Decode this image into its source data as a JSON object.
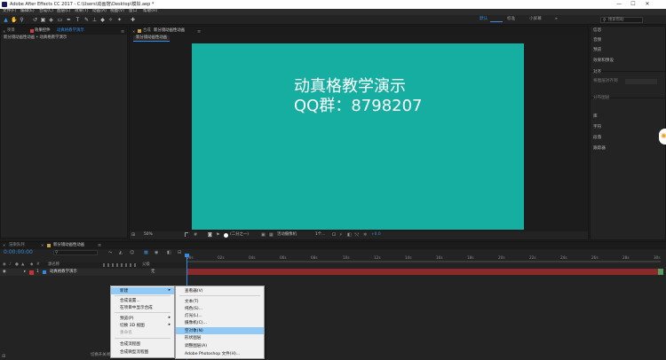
{
  "window": {
    "title": "Adobe After Effects CC 2017 - C:\\Users\\动画馆\\Desktop\\模拟.aep *",
    "minimize": "—",
    "maximize": "☐",
    "close": "✕"
  },
  "menubar": [
    "文件(F)",
    "编辑(E)",
    "合成(C)",
    "图层(L)",
    "效果(T)",
    "动画(A)",
    "视图(V)",
    "窗口",
    "帮助(H)"
  ],
  "toolbar": {
    "workspaces": [
      "默认",
      "标准",
      "小屏幕"
    ],
    "active_workspace": "默认",
    "more": "»",
    "search_placeholder": "搜索帮助"
  },
  "project_panel": {
    "tab_project": "项目",
    "tab_effect_controls": "效果控件",
    "tab_effect_target": "动真格教学演示",
    "path": "新分镜动画性动画 • 动真格教学演示"
  },
  "comp_panel": {
    "tab_prefix": "合成",
    "tab_name": "新分镜动画性动画",
    "sub_tab": "新分镜动画性动画",
    "line1": "动真格教学演示",
    "line2": "QQ群：8798207",
    "zoom": "50%",
    "resolution": "(二分之一)",
    "camera": "活动摄像机",
    "views": "1个...",
    "exposure": "+0.0",
    "canvas_color": "#15aea0"
  },
  "right_panel": {
    "items": [
      "信息",
      "音频",
      "预览",
      "效果和预设",
      "对齐",
      "将图层对齐到",
      "分布图层",
      "库",
      "字符",
      "段落",
      "跟踪器"
    ]
  },
  "timeline": {
    "tab_render": "渲染队列",
    "tab_comp": "新分镜动画性动画",
    "timecode": "0:00:00:00",
    "col_source": "源名称",
    "col_parent": "父级",
    "layer_index": "1",
    "layer_name": "动真格教学演示",
    "parent_value": "无",
    "ruler": [
      "00s",
      "02s",
      "04s",
      "06s",
      "08s",
      "10s",
      "12s",
      "14s",
      "16s",
      "18s",
      "20s",
      "22s",
      "24s",
      "26s",
      "28s",
      "30s"
    ],
    "footer": "切换开关/模式"
  },
  "context_menu": {
    "items": [
      {
        "label": "新建",
        "arrow": "▸",
        "highlight": true
      },
      {
        "sep": true
      },
      {
        "label": "合成设置..."
      },
      {
        "label": "在项目中显示合成"
      },
      {
        "sep": true
      },
      {
        "label": "预览(P)",
        "arrow": "▸"
      },
      {
        "label": "切换 3D 视图",
        "arrow": "▸"
      },
      {
        "label": "重命名",
        "disabled": true
      },
      {
        "sep": true
      },
      {
        "label": "合成流程图"
      },
      {
        "label": "合成微型流程图"
      }
    ]
  },
  "submenu": {
    "items": [
      {
        "label": "查看器(V)"
      },
      {
        "sep": true
      },
      {
        "label": "文本(T)"
      },
      {
        "label": "纯色(S)..."
      },
      {
        "label": "灯光(L)..."
      },
      {
        "label": "摄像机(C)..."
      },
      {
        "label": "空对象(N)",
        "highlight": true
      },
      {
        "label": "形状图层"
      },
      {
        "label": "调整图层(A)"
      },
      {
        "label": "Adobe Photoshop 文件(H)..."
      }
    ]
  }
}
